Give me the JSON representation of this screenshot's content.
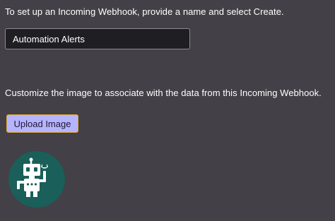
{
  "intro_text": "To set up an Incoming Webhook, provide a name and select Create.",
  "name_field": {
    "value": "Automation Alerts"
  },
  "image_prompt": "Customize the image to associate with the data from this Incoming Webhook.",
  "upload_button_label": "Upload Image",
  "avatar": {
    "icon": "robot-icon",
    "background_color": "#1a5f59",
    "figure_color": "#ffffff"
  },
  "colors": {
    "page_background": "#434047",
    "input_background": "#1f1e22",
    "button_background": "#b7b4ff",
    "button_border": "#d9a83c"
  }
}
